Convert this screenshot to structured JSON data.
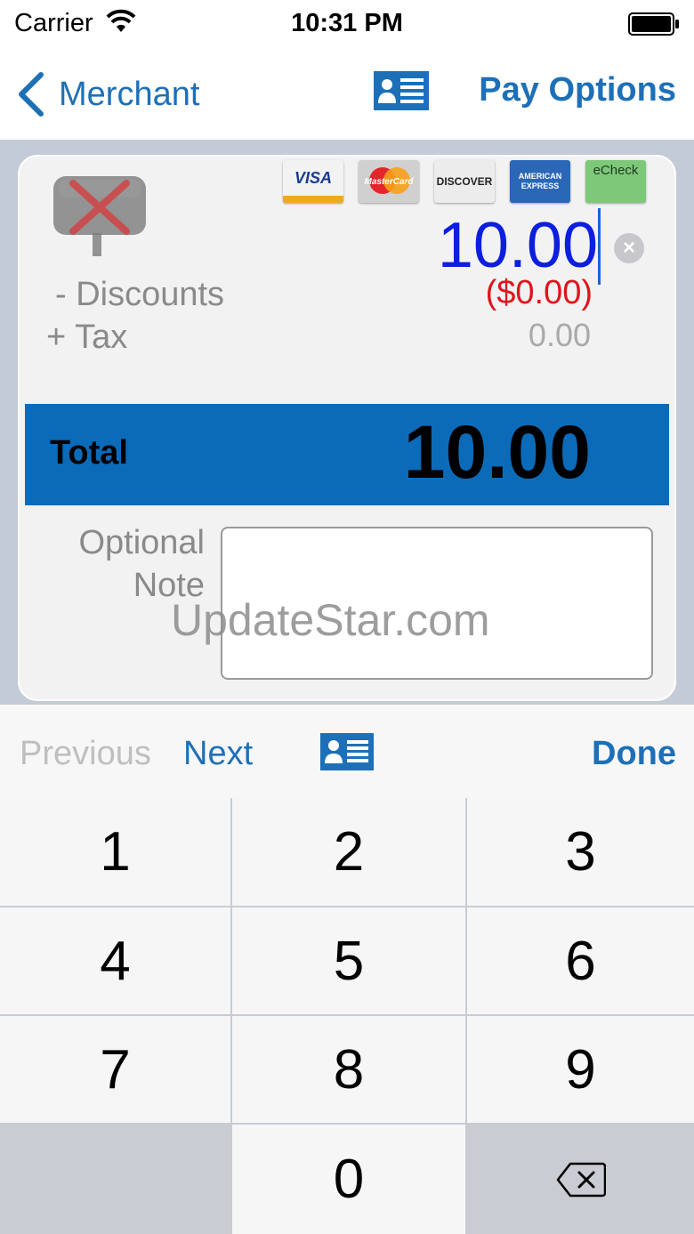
{
  "status_bar": {
    "carrier": "Carrier",
    "time": "10:31 PM"
  },
  "nav": {
    "back_label": "Merchant",
    "right_label": "Pay Options"
  },
  "payment_methods": [
    {
      "label": "VISA",
      "bg": "#f2f2f2",
      "color": "#1a3b8e"
    },
    {
      "label": "MasterCard",
      "bg": "#d0d0d0",
      "color": "#ffffff"
    },
    {
      "label": "DISCOVER",
      "bg": "#ececec",
      "color": "#222222"
    },
    {
      "label": "AMERICAN EXPRESS",
      "bg": "#2a67b7",
      "color": "#ffffff"
    },
    {
      "label": "eCheck",
      "bg": "#7ec87a",
      "color": "#1f3b1f"
    }
  ],
  "amount": {
    "value": "10.00",
    "discounts_label": "- Discounts",
    "discounts_value": "($0.00)",
    "tax_label": "+ Tax",
    "tax_value": "0.00"
  },
  "total": {
    "label": "Total",
    "value": "10.00"
  },
  "note": {
    "label_line1": "Optional",
    "label_line2": "Note",
    "value": ""
  },
  "watermark": "UpdateStar.com",
  "toolbar": {
    "previous": "Previous",
    "next": "Next",
    "done": "Done"
  },
  "keypad": {
    "keys": [
      "1",
      "2",
      "3",
      "4",
      "5",
      "6",
      "7",
      "8",
      "9",
      "0"
    ]
  },
  "colors": {
    "accent": "#1d70b7",
    "total_bar": "#0c6bb8",
    "amount_text": "#0c1ee0",
    "discount_text": "#e0141b"
  }
}
